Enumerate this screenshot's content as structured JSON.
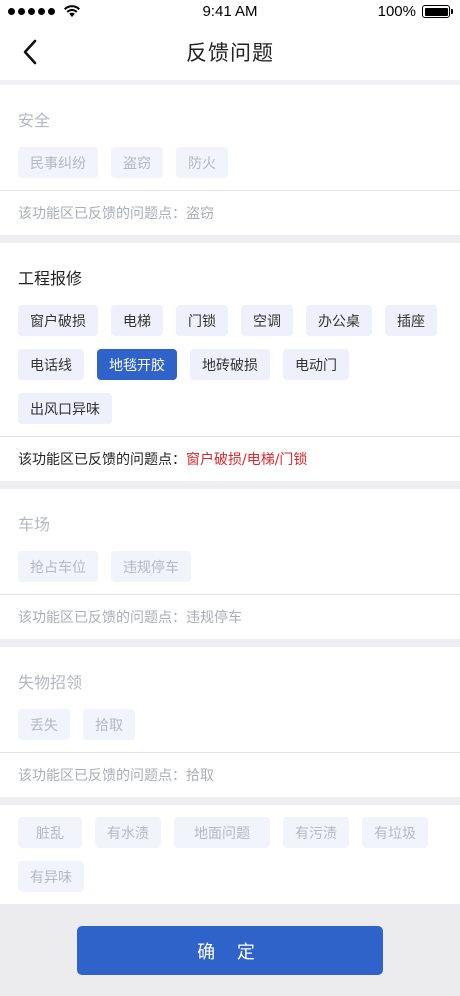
{
  "status_bar": {
    "time": "9:41 AM",
    "battery": "100%"
  },
  "nav": {
    "title": "反馈问题"
  },
  "sections": [
    {
      "title": "安全",
      "tags": [
        "民事纠纷",
        "盗窃",
        "防火"
      ],
      "reported_label": "该功能区已反馈的问题点：",
      "reported_value": "盗窃"
    },
    {
      "title": "工程报修",
      "tags": [
        "窗户破损",
        "电梯",
        "门锁",
        "空调",
        "办公桌",
        "插座",
        "电话线",
        "地毯开胶",
        "地砖破损",
        "电动门",
        "出风口异味"
      ],
      "selected": "地毯开胶",
      "reported_label": "该功能区已反馈的问题点：",
      "reported_value": "窗户破损/电梯/门锁"
    },
    {
      "title": "车场",
      "tags": [
        "抢占车位",
        "违规停车"
      ],
      "reported_label": "该功能区已反馈的问题点：",
      "reported_value": "违规停车"
    },
    {
      "title": "失物招领",
      "tags": [
        "丢失",
        "拾取"
      ],
      "reported_label": "该功能区已反馈的问题点：",
      "reported_value": "拾取"
    },
    {
      "tags": [
        "脏乱",
        "有水渍",
        "地面问题",
        "有污渍",
        "有垃圾",
        "有异味"
      ]
    }
  ],
  "footer": {
    "confirm_label": "确 定"
  },
  "colors": {
    "accent": "#2f63c9",
    "highlight": "#e0262b"
  },
  "icons": {
    "back": "chevron-left-icon",
    "wifi": "wifi-icon",
    "battery": "battery-icon"
  }
}
